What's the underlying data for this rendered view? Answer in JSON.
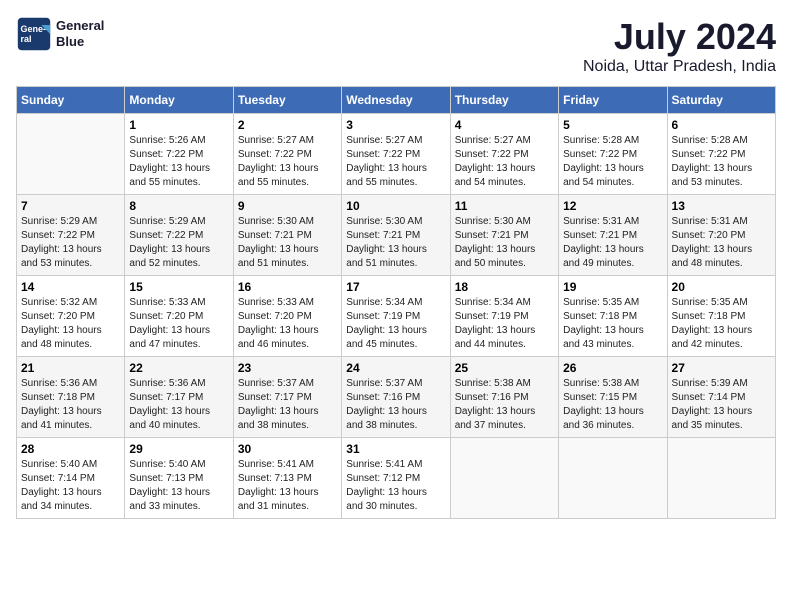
{
  "header": {
    "logo_line1": "General",
    "logo_line2": "Blue",
    "month": "July 2024",
    "location": "Noida, Uttar Pradesh, India"
  },
  "weekdays": [
    "Sunday",
    "Monday",
    "Tuesday",
    "Wednesday",
    "Thursday",
    "Friday",
    "Saturday"
  ],
  "weeks": [
    [
      {
        "day": "",
        "info": ""
      },
      {
        "day": "1",
        "info": "Sunrise: 5:26 AM\nSunset: 7:22 PM\nDaylight: 13 hours\nand 55 minutes."
      },
      {
        "day": "2",
        "info": "Sunrise: 5:27 AM\nSunset: 7:22 PM\nDaylight: 13 hours\nand 55 minutes."
      },
      {
        "day": "3",
        "info": "Sunrise: 5:27 AM\nSunset: 7:22 PM\nDaylight: 13 hours\nand 55 minutes."
      },
      {
        "day": "4",
        "info": "Sunrise: 5:27 AM\nSunset: 7:22 PM\nDaylight: 13 hours\nand 54 minutes."
      },
      {
        "day": "5",
        "info": "Sunrise: 5:28 AM\nSunset: 7:22 PM\nDaylight: 13 hours\nand 54 minutes."
      },
      {
        "day": "6",
        "info": "Sunrise: 5:28 AM\nSunset: 7:22 PM\nDaylight: 13 hours\nand 53 minutes."
      }
    ],
    [
      {
        "day": "7",
        "info": "Sunrise: 5:29 AM\nSunset: 7:22 PM\nDaylight: 13 hours\nand 53 minutes."
      },
      {
        "day": "8",
        "info": "Sunrise: 5:29 AM\nSunset: 7:22 PM\nDaylight: 13 hours\nand 52 minutes."
      },
      {
        "day": "9",
        "info": "Sunrise: 5:30 AM\nSunset: 7:21 PM\nDaylight: 13 hours\nand 51 minutes."
      },
      {
        "day": "10",
        "info": "Sunrise: 5:30 AM\nSunset: 7:21 PM\nDaylight: 13 hours\nand 51 minutes."
      },
      {
        "day": "11",
        "info": "Sunrise: 5:30 AM\nSunset: 7:21 PM\nDaylight: 13 hours\nand 50 minutes."
      },
      {
        "day": "12",
        "info": "Sunrise: 5:31 AM\nSunset: 7:21 PM\nDaylight: 13 hours\nand 49 minutes."
      },
      {
        "day": "13",
        "info": "Sunrise: 5:31 AM\nSunset: 7:20 PM\nDaylight: 13 hours\nand 48 minutes."
      }
    ],
    [
      {
        "day": "14",
        "info": "Sunrise: 5:32 AM\nSunset: 7:20 PM\nDaylight: 13 hours\nand 48 minutes."
      },
      {
        "day": "15",
        "info": "Sunrise: 5:33 AM\nSunset: 7:20 PM\nDaylight: 13 hours\nand 47 minutes."
      },
      {
        "day": "16",
        "info": "Sunrise: 5:33 AM\nSunset: 7:20 PM\nDaylight: 13 hours\nand 46 minutes."
      },
      {
        "day": "17",
        "info": "Sunrise: 5:34 AM\nSunset: 7:19 PM\nDaylight: 13 hours\nand 45 minutes."
      },
      {
        "day": "18",
        "info": "Sunrise: 5:34 AM\nSunset: 7:19 PM\nDaylight: 13 hours\nand 44 minutes."
      },
      {
        "day": "19",
        "info": "Sunrise: 5:35 AM\nSunset: 7:18 PM\nDaylight: 13 hours\nand 43 minutes."
      },
      {
        "day": "20",
        "info": "Sunrise: 5:35 AM\nSunset: 7:18 PM\nDaylight: 13 hours\nand 42 minutes."
      }
    ],
    [
      {
        "day": "21",
        "info": "Sunrise: 5:36 AM\nSunset: 7:18 PM\nDaylight: 13 hours\nand 41 minutes."
      },
      {
        "day": "22",
        "info": "Sunrise: 5:36 AM\nSunset: 7:17 PM\nDaylight: 13 hours\nand 40 minutes."
      },
      {
        "day": "23",
        "info": "Sunrise: 5:37 AM\nSunset: 7:17 PM\nDaylight: 13 hours\nand 38 minutes."
      },
      {
        "day": "24",
        "info": "Sunrise: 5:37 AM\nSunset: 7:16 PM\nDaylight: 13 hours\nand 38 minutes."
      },
      {
        "day": "25",
        "info": "Sunrise: 5:38 AM\nSunset: 7:16 PM\nDaylight: 13 hours\nand 37 minutes."
      },
      {
        "day": "26",
        "info": "Sunrise: 5:38 AM\nSunset: 7:15 PM\nDaylight: 13 hours\nand 36 minutes."
      },
      {
        "day": "27",
        "info": "Sunrise: 5:39 AM\nSunset: 7:14 PM\nDaylight: 13 hours\nand 35 minutes."
      }
    ],
    [
      {
        "day": "28",
        "info": "Sunrise: 5:40 AM\nSunset: 7:14 PM\nDaylight: 13 hours\nand 34 minutes."
      },
      {
        "day": "29",
        "info": "Sunrise: 5:40 AM\nSunset: 7:13 PM\nDaylight: 13 hours\nand 33 minutes."
      },
      {
        "day": "30",
        "info": "Sunrise: 5:41 AM\nSunset: 7:13 PM\nDaylight: 13 hours\nand 31 minutes."
      },
      {
        "day": "31",
        "info": "Sunrise: 5:41 AM\nSunset: 7:12 PM\nDaylight: 13 hours\nand 30 minutes."
      },
      {
        "day": "",
        "info": ""
      },
      {
        "day": "",
        "info": ""
      },
      {
        "day": "",
        "info": ""
      }
    ]
  ]
}
